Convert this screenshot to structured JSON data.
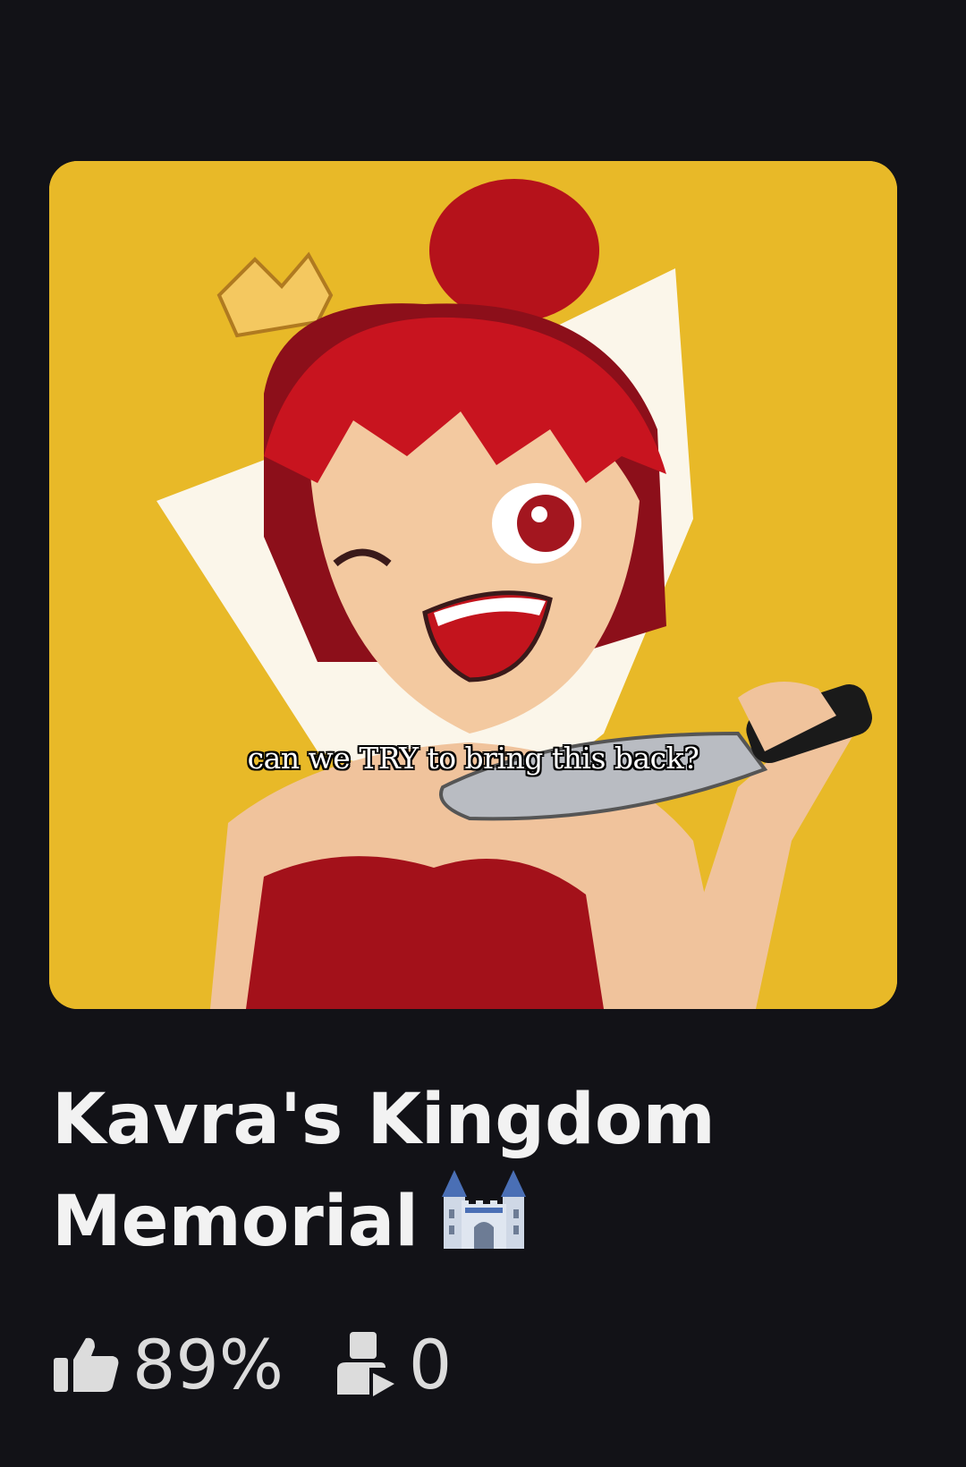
{
  "game": {
    "title_line1": "Kavra's Kingdom",
    "title_line2": "Memorial",
    "title_emoji_icon": "castle-icon",
    "thumbnail_caption": "can we TRY to bring this back?",
    "like_ratio": "89%",
    "players": "0"
  },
  "icons": {
    "like": "thumbs-up-icon",
    "players": "player-count-icon"
  },
  "colors": {
    "background": "#121217",
    "thumbnail_bg": "#e8b928",
    "text": "#f2f2f2",
    "stat_text": "#dcdcdc"
  }
}
